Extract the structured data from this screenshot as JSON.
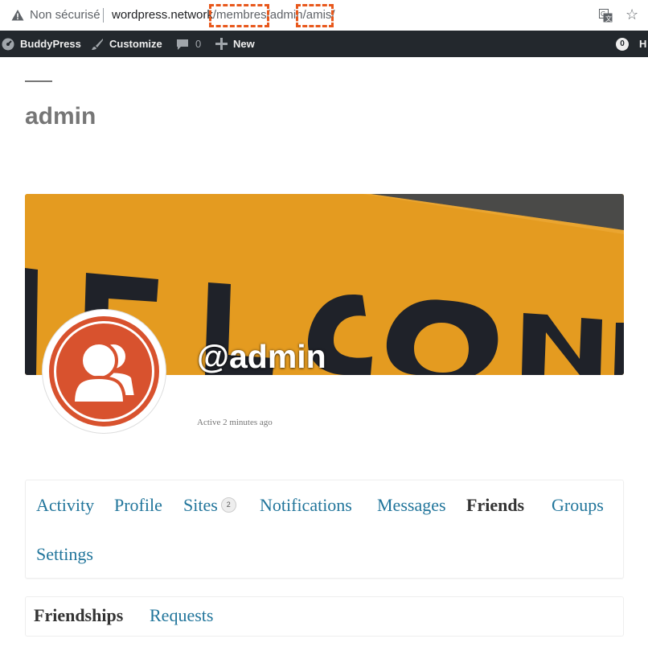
{
  "browser": {
    "security_label": "Non sécurisé",
    "url_host": "wordpress.network",
    "url_path": "/membres/admin/amis/"
  },
  "adminbar": {
    "site_name": "BuddyPress",
    "customize_label": "Customize",
    "comments_count": "0",
    "new_label": "New",
    "notifications_count": "0",
    "howdy_partial": "H"
  },
  "page": {
    "title": "admin"
  },
  "profile": {
    "username": "@admin",
    "last_active": "Active 2 minutes ago"
  },
  "nav": {
    "items": [
      {
        "label": "Activity",
        "count": null,
        "current": false
      },
      {
        "label": "Profile",
        "count": null,
        "current": false
      },
      {
        "label": "Sites",
        "count": "2",
        "current": false
      },
      {
        "label": "Notifications",
        "count": null,
        "current": false
      },
      {
        "label": "Messages",
        "count": null,
        "current": false
      },
      {
        "label": "Friends",
        "count": null,
        "current": true
      },
      {
        "label": "Groups",
        "count": null,
        "current": false
      },
      {
        "label": "Settings",
        "count": null,
        "current": false
      }
    ]
  },
  "subnav": {
    "items": [
      {
        "label": "Friendships",
        "current": true
      },
      {
        "label": "Requests",
        "current": false
      }
    ]
  },
  "colors": {
    "link": "#21759b",
    "adminbar": "#23282d",
    "avatar": "#d8522e",
    "cover": "#e49b20",
    "highlight": "#e8581c"
  }
}
